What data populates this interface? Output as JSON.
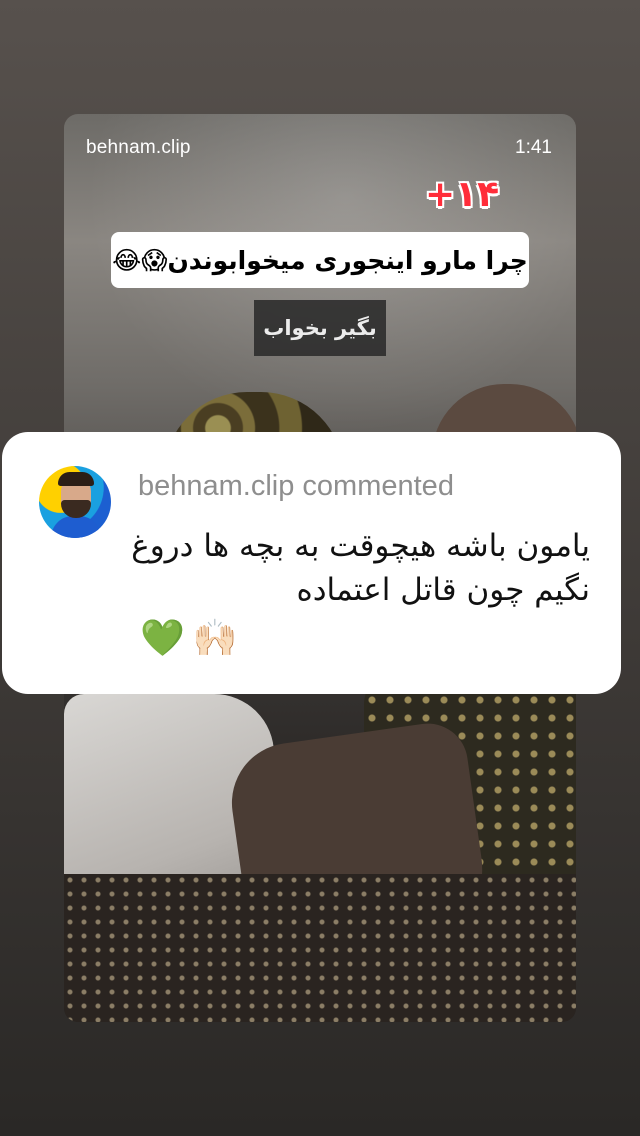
{
  "story": {
    "username": "behnam.clip",
    "timestamp": "1:41",
    "age_badge": "+۱۴",
    "title_caption": "چرا مارو اینجوری میخوابوندن😱😂",
    "sub_caption": "بگیر بخواب"
  },
  "comment": {
    "header": "behnam.clip commented",
    "text": "یامون باشه هیچوقت به بچه ها دروغ نگیم چون قاتل اعتماده",
    "emojis": [
      "💚",
      "🙌🏻"
    ]
  },
  "colors": {
    "badge_red": "#ff2d3a",
    "heart_green": "#24c53a",
    "comment_meta_gray": "#8e8e8e"
  },
  "icons": [
    "avatar",
    "green-heart-emoji",
    "raised-hands-emoji"
  ]
}
